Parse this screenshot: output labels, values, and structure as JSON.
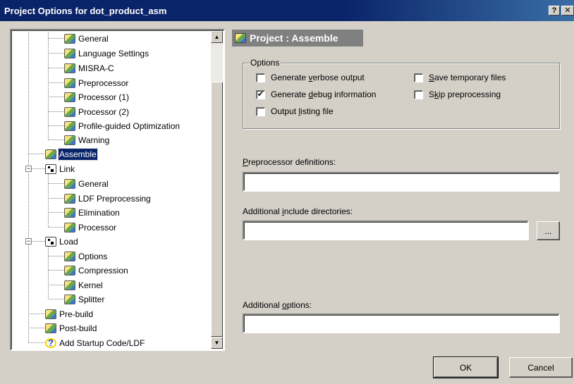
{
  "window": {
    "title": "Project Options for dot_product_asm",
    "help_btn": "?",
    "close_btn": "✕"
  },
  "tree": {
    "items": [
      {
        "label": "General"
      },
      {
        "label": "Language Settings"
      },
      {
        "label": "MISRA-C"
      },
      {
        "label": "Preprocessor"
      },
      {
        "label": "Processor (1)"
      },
      {
        "label": "Processor (2)"
      },
      {
        "label": "Profile-guided Optimization"
      },
      {
        "label": "Warning"
      },
      {
        "label": "Assemble",
        "selected": true
      },
      {
        "label": "Link",
        "expanded": true
      },
      {
        "label": "General"
      },
      {
        "label": "LDF Preprocessing"
      },
      {
        "label": "Elimination"
      },
      {
        "label": "Processor"
      },
      {
        "label": "Load",
        "expanded": true
      },
      {
        "label": "Options"
      },
      {
        "label": "Compression"
      },
      {
        "label": "Kernel"
      },
      {
        "label": "Splitter"
      },
      {
        "label": "Pre-build"
      },
      {
        "label": "Post-build"
      },
      {
        "label": "Add Startup Code/LDF"
      }
    ],
    "expander_minus": "−"
  },
  "scrollbar": {
    "up_arrow": "▲",
    "down_arrow": "▼"
  },
  "page": {
    "header": "Project : Assemble"
  },
  "options_group": {
    "legend": "Options",
    "checkboxes": [
      {
        "pre": "Generate ",
        "ul": "v",
        "post": "erbose output",
        "checked": false
      },
      {
        "pre": "Generate ",
        "ul": "d",
        "post": "ebug information",
        "checked": true
      },
      {
        "pre": "Output ",
        "ul": "l",
        "post": "isting file",
        "checked": false
      },
      {
        "pre": "",
        "ul": "S",
        "post": "ave temporary files",
        "checked": false
      },
      {
        "pre": "S",
        "ul": "k",
        "post": "ip preprocessing",
        "checked": false
      }
    ],
    "check_mark": "✔"
  },
  "fields": {
    "preprocessor": {
      "pre": "",
      "ul": "P",
      "post": "reprocessor definitions:",
      "value": ""
    },
    "include_dirs": {
      "pre": "Additional ",
      "ul": "i",
      "post": "nclude directories:",
      "value": ""
    },
    "browse_label": "...",
    "additional": {
      "pre": "Additional ",
      "ul": "o",
      "post": "ptions:",
      "value": ""
    }
  },
  "buttons": {
    "ok": "OK",
    "cancel": "Cancel"
  }
}
